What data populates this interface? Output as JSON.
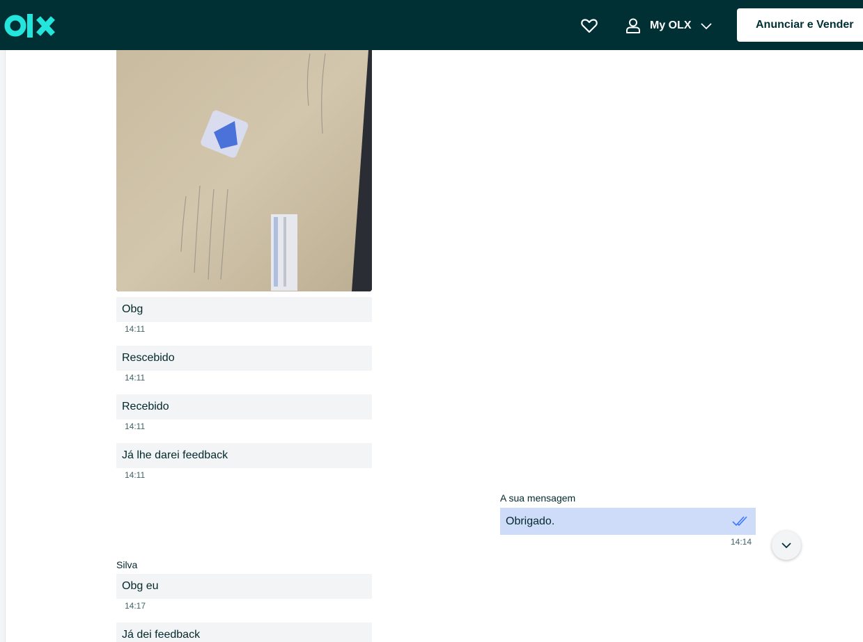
{
  "header": {
    "logo_alt": "olx",
    "favorites_icon": "heart-icon",
    "account_label": "My OLX",
    "sell_button": "Anunciar e Vender"
  },
  "messages": {
    "incoming_1": {
      "text": "Obg",
      "time": "14:11"
    },
    "incoming_2": {
      "text": "Rescebido",
      "time": "14:11"
    },
    "incoming_3": {
      "text": "Recebido",
      "time": "14:11"
    },
    "incoming_4": {
      "text": "Já lhe darei feedback",
      "time": "14:11"
    },
    "mine_label": "A sua mensagem",
    "mine_1": {
      "text": "Obrigado.",
      "time": "14:14",
      "status_icon": "double-check-icon"
    },
    "sender_name": "Silva",
    "incoming_5": {
      "text": "Obg eu",
      "time": "14:17"
    },
    "incoming_6": {
      "text": "Já dei feedback"
    }
  },
  "colors": {
    "header_bg": "#002f34",
    "logo_teal": "#23e5db",
    "incoming_bubble": "#f2f4f5",
    "outgoing_bubble": "#cedcfa"
  }
}
